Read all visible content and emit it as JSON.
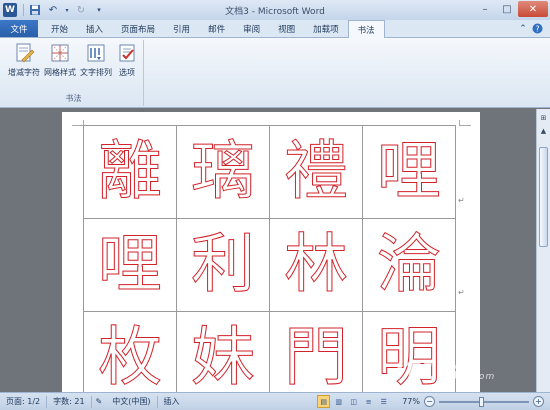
{
  "window": {
    "title": "文档3 - Microsoft Word"
  },
  "tabs": [
    {
      "label": "文件",
      "kind": "file"
    },
    {
      "label": "开始"
    },
    {
      "label": "插入"
    },
    {
      "label": "页面布局"
    },
    {
      "label": "引用"
    },
    {
      "label": "邮件"
    },
    {
      "label": "审阅"
    },
    {
      "label": "视图"
    },
    {
      "label": "加载项"
    },
    {
      "label": "书法",
      "active": true
    }
  ],
  "ribbon": {
    "group_label": "书法",
    "buttons": [
      {
        "label": "增减字符",
        "icon": "add-remove-chars-icon"
      },
      {
        "label": "网格样式",
        "icon": "grid-style-icon"
      },
      {
        "label": "文字排列",
        "icon": "text-arrange-icon"
      },
      {
        "label": "选项",
        "icon": "options-icon"
      }
    ]
  },
  "document": {
    "grid_rows": [
      [
        "離",
        "璃",
        "禮",
        "哩"
      ],
      [
        "哩",
        "利",
        "林",
        "淪"
      ],
      [
        "枚",
        "妹",
        "門",
        "明"
      ]
    ],
    "glyph_color": "#d2232a"
  },
  "statusbar": {
    "page": "页面: 1/2",
    "words": "字数: 21",
    "language": "中文(中国)",
    "mode": "插入",
    "zoom": "77%"
  },
  "watermark": {
    "text": "IT168",
    "suffix": ".com"
  }
}
